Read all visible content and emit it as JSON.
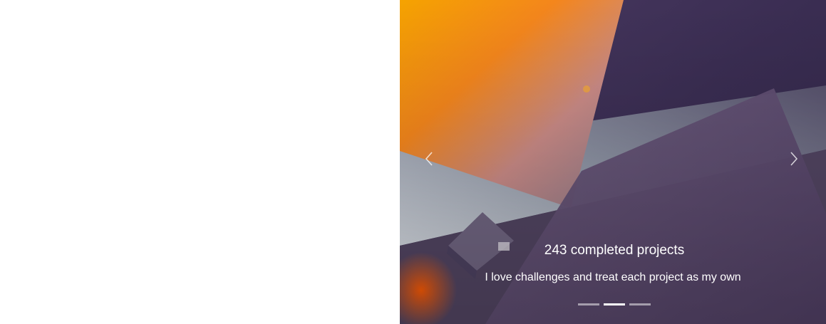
{
  "carousel": {
    "slide": {
      "title": "243 completed projects",
      "text": "I love challenges and treat each project as my own"
    },
    "prev_icon": "chevron-left-icon",
    "next_icon": "chevron-right-icon",
    "indicators": {
      "count": 3,
      "active_index": 1
    },
    "colors": {
      "orange": "#f39a1a",
      "deep_orange": "#f26a1c",
      "purple": "#3a2d52",
      "mauve": "#5e4a6e",
      "silver": "#c9d0d6"
    }
  }
}
